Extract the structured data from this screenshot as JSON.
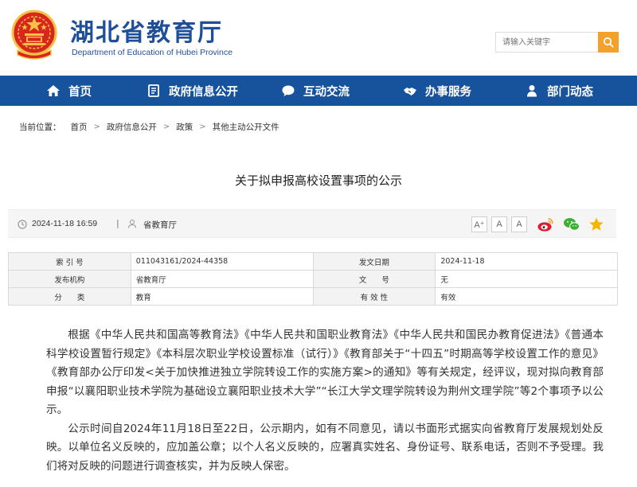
{
  "header": {
    "site_title": "湖北省教育厅",
    "site_subtitle": "Department of Education of Hubei Province",
    "search_placeholder": "请输入关键字",
    "colors": {
      "brand": "#1f4f9a",
      "search_button": "#f3a12a",
      "emblem_red": "#d7261e",
      "emblem_gold": "#f6c244"
    }
  },
  "nav": {
    "background": "#17529c",
    "items": [
      {
        "label": "首页",
        "icon": "home-icon"
      },
      {
        "label": "政府信息公开",
        "icon": "document-icon"
      },
      {
        "label": "互动交流",
        "icon": "chat-bubble-icon"
      },
      {
        "label": "办事服务",
        "icon": "handshake-icon"
      },
      {
        "label": "部门动态",
        "icon": "person-icon"
      }
    ]
  },
  "breadcrumb": {
    "lead": "当前位置：",
    "items": [
      "首页",
      "政府信息公开",
      "政策",
      "其他主动公开文件"
    ],
    "separator": ">"
  },
  "article": {
    "title": "关于拟申报高校设置事项的公示",
    "datetime": "2024-11-18 16:59",
    "divider": "|",
    "source": "省教育厅",
    "font_sizes": [
      "A⁺",
      "A",
      "A"
    ],
    "share_icons": [
      "weibo-icon",
      "wechat-icon",
      "favorite-star-icon"
    ]
  },
  "info": {
    "rows": [
      {
        "k1": "索 引 号",
        "v1": "011043161/2024-44358",
        "k2": "发文日期",
        "v2": "2024-11-18"
      },
      {
        "k1": "发布机构",
        "v1": "省教育厅",
        "k2": "文　　号",
        "v2": "无"
      },
      {
        "k1": "分　　类",
        "v1": "教育",
        "k2": "有 效 性",
        "v2": "有效"
      }
    ]
  },
  "body": {
    "p1": "根据《中华人民共和国高等教育法》《中华人民共和国职业教育法》《中华人民共和国民办教育促进法》《普通本科学校设置暂行规定》《本科层次职业学校设置标准（试行）》《教育部关于“十四五”时期高等学校设置工作的意见》《教育部办公厅印发<关于加快推进独立学院转设工作的实施方案>的通知》等有关规定，经评议，现对拟向教育部申报“以襄阳职业技术学院为基础设立襄阳职业技术大学”“长江大学文理学院转设为荆州文理学院”等2个事项予以公示。",
    "p2": "公示时间自2024年11月18日至22日，公示期内，如有不同意见，请以书面形式据实向省教育厅发展规划处反映。以单位名义反映的，应加盖公章；以个人名义反映的，应署真实姓名、身份证号、联系电话，否则不予受理。我们将对反映的问题进行调查核实，并为反映人保密。"
  }
}
